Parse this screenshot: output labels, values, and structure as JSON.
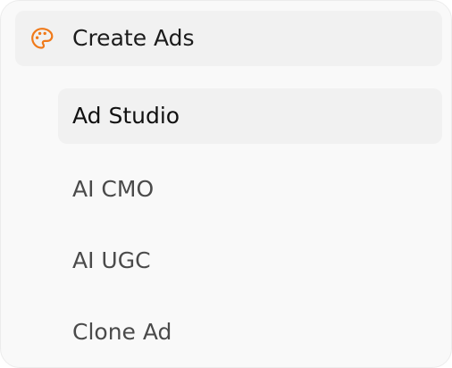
{
  "nav": {
    "group": {
      "label": "Create Ads",
      "icon": "palette-icon",
      "accent_color": "#F07A1A"
    },
    "items": [
      {
        "label": "Ad Studio",
        "active": true
      },
      {
        "label": "AI CMO",
        "active": false
      },
      {
        "label": "AI UGC",
        "active": false
      },
      {
        "label": "Clone Ad",
        "active": false
      }
    ]
  }
}
